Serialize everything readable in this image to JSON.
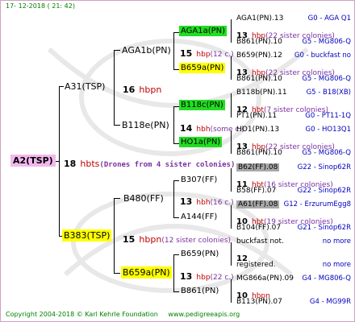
{
  "header": {
    "date": "17- 12-2018 ( 21: 42)"
  },
  "root": {
    "name": "A2(TSP)",
    "count": "18",
    "hb": "hbts",
    "note": "(Drones from 4 sister colonies)"
  },
  "gen1": [
    {
      "name": "A31(TSP)",
      "count": "16",
      "hb": "hbpn",
      "note": ""
    },
    {
      "name": "B383(TSP)",
      "count": "15",
      "hb": "hbpn",
      "note": "(12 sister colonies)"
    }
  ],
  "gen2": [
    {
      "name": "AGA1b(PN)",
      "count": "15",
      "hb": "hbp",
      "note": "(12 c.)"
    },
    {
      "name": "B118e(PN)",
      "count": "14",
      "hb": "hbh",
      "note": "(some c.)"
    },
    {
      "name": "B480(FF)",
      "count": "13",
      "hb": "hbh",
      "note": "(16 c.)"
    },
    {
      "name": "B659a(PN)",
      "count": "13",
      "hb": "hbp",
      "note": "(22 c.)"
    }
  ],
  "gen3": [
    {
      "name": "AGA1a(PN)",
      "count": "13",
      "hb": "hbp",
      "note": "(22 sister colonies)"
    },
    {
      "name": "B659a(PN)",
      "count": "13",
      "hb": "hbp",
      "note": "(22 sister colonies)"
    },
    {
      "name": "B118c(PN)",
      "count": "12",
      "hb": "hbt",
      "note": "(7 sister colonies)"
    },
    {
      "name": "HO1a(PN)",
      "count": "13",
      "hb": "hbp",
      "note": "(22 sister colonies)"
    },
    {
      "name": "B307(FF)",
      "count": "11",
      "hb": "hbt",
      "note": "(16 sister colonies)"
    },
    {
      "name": "A144(FF)",
      "count": "10",
      "hb": "hbt",
      "note": "(19 sister colonies)"
    },
    {
      "name": "B659(PN)",
      "count": "12",
      "hb": "",
      "note": ""
    },
    {
      "name": "B861(PN)",
      "count": "10",
      "hb": "hbpn",
      "note": ""
    }
  ],
  "gen4": [
    {
      "name": "AGA1(PN).13",
      "ref": "G0 - AGA Q1"
    },
    {
      "name": "B861(PN).10",
      "ref": "G5 - MG806-Q"
    },
    {
      "name": "B659(PN).12",
      "ref": "G0 - buckfast no"
    },
    {
      "name": "B861(PN).10",
      "ref": "G5 - MG806-Q"
    },
    {
      "name": "B118b(PN).11",
      "ref": "G5 - B18(XB)"
    },
    {
      "name": "PT1(PN).11",
      "ref": "G0 - PT11-1Q"
    },
    {
      "name": "HO1(PN).13",
      "ref": "G0 - HO13Q1"
    },
    {
      "name": "B861(PN).10",
      "ref": "G5 - MG806-Q"
    },
    {
      "name": "B62(FF).08",
      "ref": "G22 - Sinop62R"
    },
    {
      "name": "B58(FF).07",
      "ref": "G22 - Sinop62R"
    },
    {
      "name": "A61(FF).08",
      "ref": "G12 - ErzurumEgg8"
    },
    {
      "name": "B104(FF).07",
      "ref": "G21 - Sinop62R"
    },
    {
      "name": "buckfast not.",
      "ref": "no more"
    },
    {
      "name": "registered.",
      "ref": "no more"
    },
    {
      "name": "MG866a(PN).09",
      "ref": "G4 - MG806-Q"
    },
    {
      "name": "B113(PN).07",
      "ref": "G4 - MG99R"
    }
  ],
  "footer": {
    "copyright": "Copyright 2004-2018 © Karl Kehrle Foundation",
    "url": "www.pedigreeapis.org"
  },
  "colors": {
    "pink": "#f2b8ee",
    "yellow": "#ffff00",
    "green": "#22dd22",
    "gray": "#a8a8a8",
    "red": "#c00000",
    "blue": "#0000c0",
    "purple": "#7a30a0",
    "footer": "#008000"
  }
}
